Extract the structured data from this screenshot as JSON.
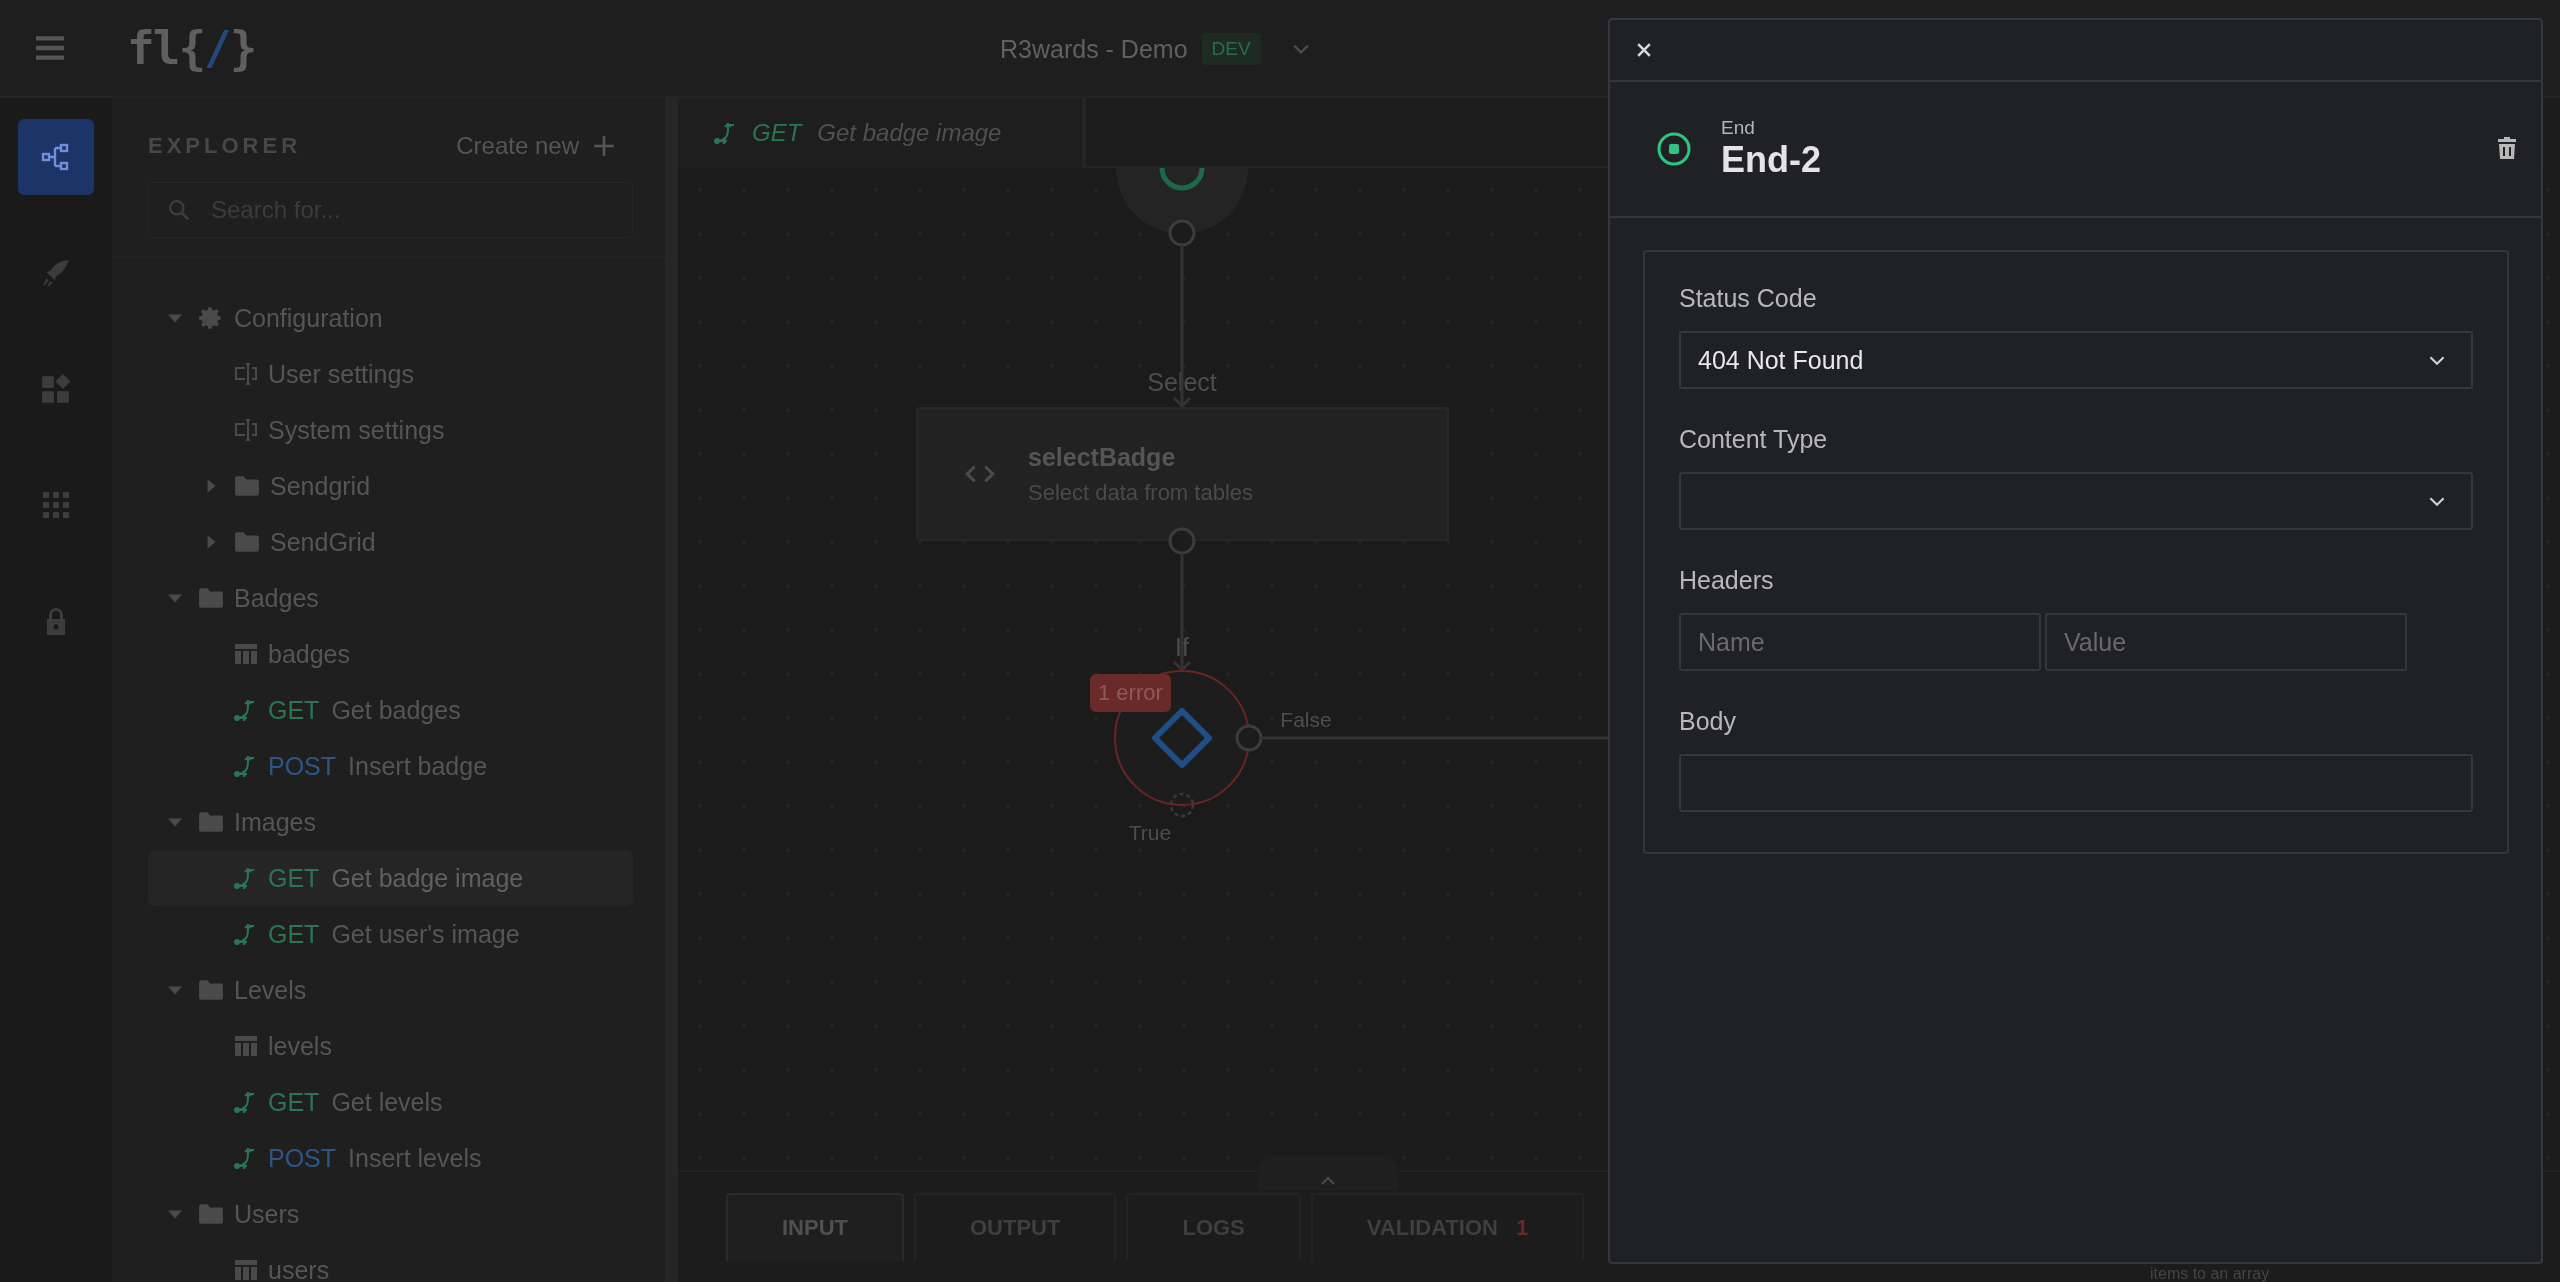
{
  "header": {
    "logo": {
      "prefix": "fl{",
      "mark": "/",
      "suffix": "}"
    },
    "app_title": "R3wards - Demo",
    "environment": "DEV"
  },
  "nav_rail": [
    {
      "kind": "flows",
      "selected": true
    },
    {
      "kind": "deploy",
      "selected": false
    },
    {
      "kind": "components",
      "selected": false
    },
    {
      "kind": "apps",
      "selected": false
    },
    {
      "kind": "security",
      "selected": false
    }
  ],
  "explorer": {
    "title": "EXPLORER",
    "create_label": "Create new",
    "search_placeholder": "Search for...",
    "tree": [
      {
        "kind": "config",
        "label": "Configuration",
        "expanded": true,
        "selected": false,
        "children": [
          {
            "kind": "setting",
            "label": "User settings",
            "selected": false
          },
          {
            "kind": "setting",
            "label": "System settings",
            "selected": false
          },
          {
            "kind": "folder",
            "label": "Sendgrid",
            "expanded": false,
            "selected": false
          },
          {
            "kind": "folder",
            "label": "SendGrid",
            "expanded": false,
            "selected": false
          }
        ]
      },
      {
        "kind": "folder",
        "label": "Badges",
        "expanded": true,
        "selected": false,
        "children": [
          {
            "kind": "table",
            "label": "badges",
            "selected": false
          },
          {
            "kind": "endpoint",
            "method": "GET",
            "color": "#2a7553",
            "label": "Get badges",
            "selected": false
          },
          {
            "kind": "endpoint",
            "method": "POST",
            "color": "#2e5584",
            "label": "Insert badge",
            "selected": false
          }
        ]
      },
      {
        "kind": "folder",
        "label": "Images",
        "expanded": true,
        "selected": false,
        "children": [
          {
            "kind": "endpoint",
            "method": "GET",
            "color": "#2a7553",
            "label": "Get badge image",
            "selected": true
          },
          {
            "kind": "endpoint",
            "method": "GET",
            "color": "#2a7553",
            "label": "Get user's image",
            "selected": false
          }
        ]
      },
      {
        "kind": "folder",
        "label": "Levels",
        "expanded": true,
        "selected": false,
        "children": [
          {
            "kind": "table",
            "label": "levels",
            "selected": false
          },
          {
            "kind": "endpoint",
            "method": "GET",
            "color": "#2a7553",
            "label": "Get levels",
            "selected": false
          },
          {
            "kind": "endpoint",
            "method": "POST",
            "color": "#2e5584",
            "label": "Insert levels",
            "selected": false
          }
        ]
      },
      {
        "kind": "folder",
        "label": "Users",
        "expanded": true,
        "selected": false,
        "children": [
          {
            "kind": "table",
            "label": "users",
            "selected": false
          }
        ]
      }
    ]
  },
  "flow_tab": {
    "method": "GET",
    "label": "Get badge image"
  },
  "canvas": {
    "select_node": {
      "step_label": "Select",
      "title": "selectBadge",
      "description": "Select data from tables"
    },
    "if_node": {
      "step_label": "If",
      "error_badge": "1 error",
      "false_label": "False",
      "true_label": "True"
    },
    "hidden_node_text": "items to an array"
  },
  "drawer_tabs": [
    {
      "label": "INPUT",
      "selected": true
    },
    {
      "label": "OUTPUT",
      "selected": false
    },
    {
      "label": "LOGS",
      "selected": false
    },
    {
      "label": "VALIDATION",
      "count": "1",
      "selected": false
    }
  ],
  "panel": {
    "node_type": "End",
    "node_name": "End-2",
    "fields": [
      {
        "kind": "select",
        "label": "Status Code",
        "value": "404 Not Found"
      },
      {
        "kind": "select",
        "label": "Content Type"
      },
      {
        "kind": "pair",
        "label": "Headers",
        "placeholders": [
          "Name",
          "Value"
        ]
      },
      {
        "kind": "text",
        "label": "Body"
      }
    ]
  }
}
